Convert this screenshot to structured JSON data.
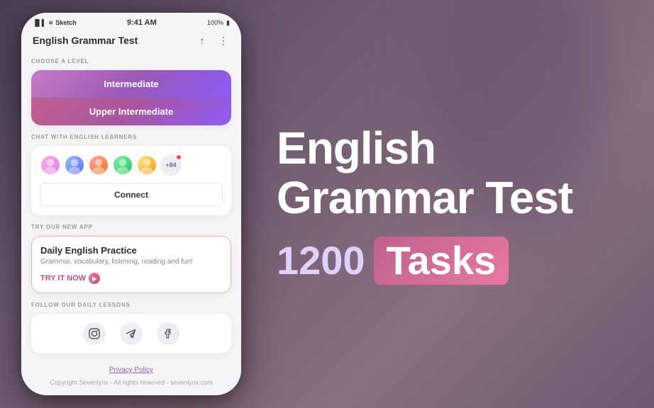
{
  "background": {
    "color": "#6b5a6e"
  },
  "statusBar": {
    "carrier": "Sketch",
    "time": "9:41 AM",
    "battery": "100%"
  },
  "appBar": {
    "title": "English Grammar Test",
    "shareIcon": "↑",
    "menuIcon": "⋮"
  },
  "sections": {
    "levelSection": {
      "label": "CHOOSE A LEVEL",
      "buttons": [
        {
          "id": "intermediate",
          "label": "Intermediate",
          "class": "intermediate"
        },
        {
          "id": "upper-intermediate",
          "label": "Upper Intermediate",
          "class": "upper-intermediate"
        }
      ]
    },
    "chatSection": {
      "label": "CHAT WITH ENGLISH LEARNERS",
      "avatarCount": "+84",
      "connectBtn": "Connect"
    },
    "newAppSection": {
      "label": "TRY OUR NEW APP",
      "title": "Daily English Practice",
      "description": "Grammar, vocabulary, listening, reading and fun!",
      "tryLabel": "TRY IT NOW"
    },
    "followSection": {
      "label": "FOLLOW OUR DAILY LESSONS",
      "icons": [
        "instagram",
        "telegram",
        "facebook"
      ]
    }
  },
  "footer": {
    "privacyLabel": "Privacy Policy",
    "copyright": "Copyright Sevenlynx - All rights reserved - sevenlynx.com"
  },
  "rightSide": {
    "heading1": "English",
    "heading2": "Grammar Test",
    "tasksNumber": "1200",
    "tasksLabel": "Tasks"
  }
}
